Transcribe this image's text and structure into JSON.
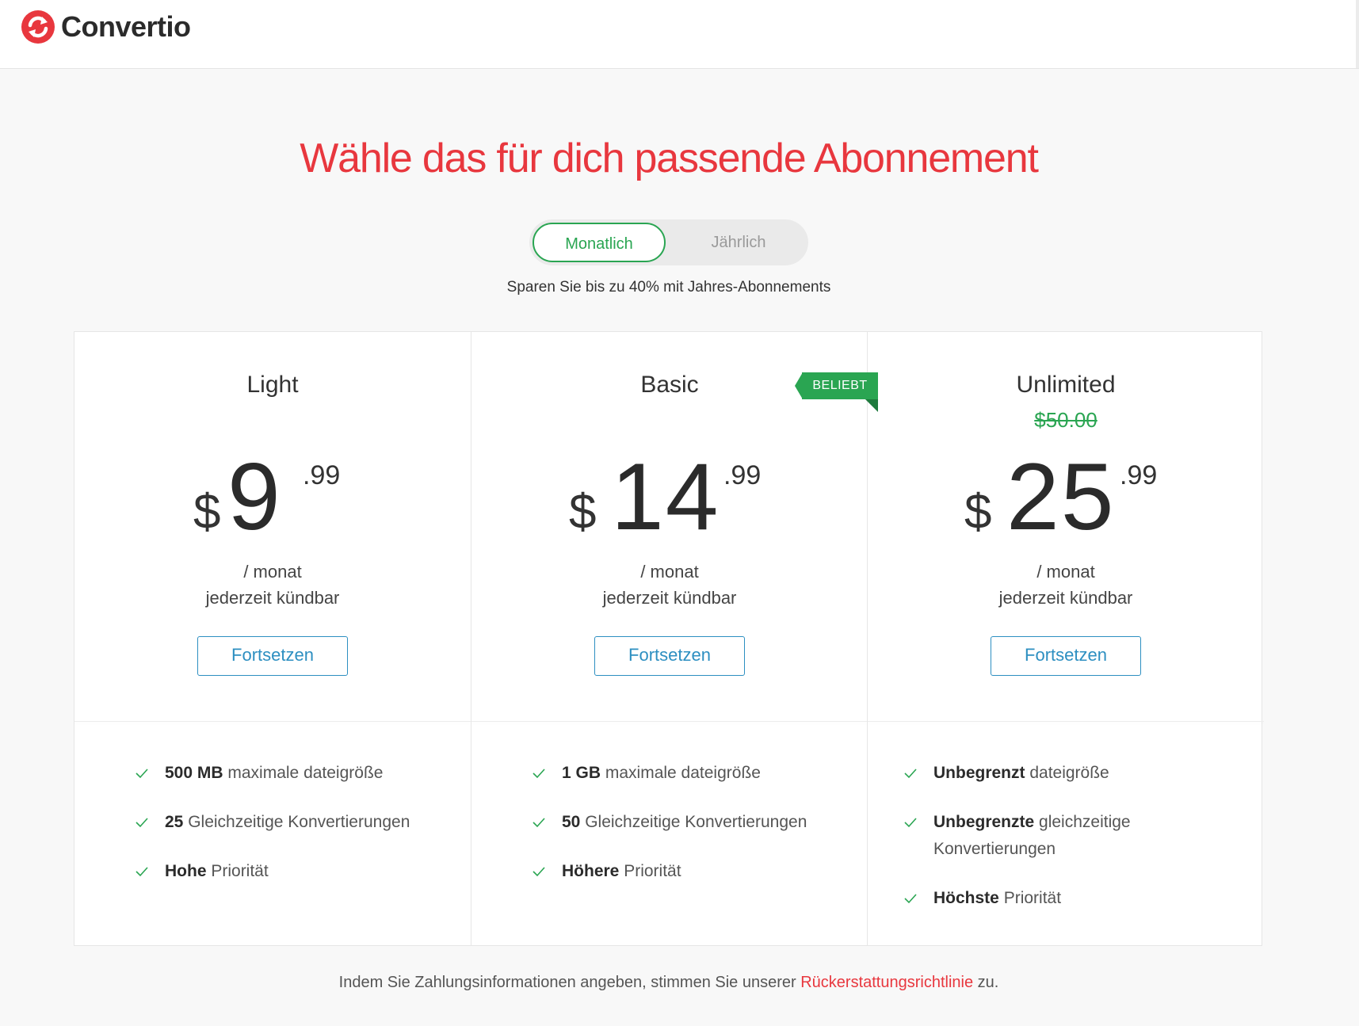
{
  "brand": {
    "name": "Convertio",
    "accent": "#e8373e"
  },
  "headline": "Wähle das für dich passende Abonnement",
  "billing_toggle": {
    "monthly": "Monatlich",
    "yearly": "Jährlich",
    "selected": "Monatlich"
  },
  "save_note": "Sparen Sie bis zu 40% mit Jahres-Abonnements",
  "plans": [
    {
      "name": "Light",
      "old_price": "",
      "currency": "$",
      "price_int": "9",
      "price_dec": ".99",
      "period": "/ monat",
      "cancel": "jederzeit kündbar",
      "button": "Fortsetzen",
      "features": [
        {
          "bold": "500 MB",
          "text": "maximale dateigröße",
          "line2": ""
        },
        {
          "bold": "25",
          "text": "Gleichzeitige Konvertierungen",
          "line2": ""
        },
        {
          "bold": "Hohe",
          "text": "Priorität",
          "line2": ""
        }
      ]
    },
    {
      "name": "Basic",
      "badge": "BELIEBT",
      "old_price": "",
      "currency": "$",
      "price_int": "14",
      "price_dec": ".99",
      "period": "/ monat",
      "cancel": "jederzeit kündbar",
      "button": "Fortsetzen",
      "features": [
        {
          "bold": "1 GB",
          "text": "maximale dateigröße",
          "line2": ""
        },
        {
          "bold": "50",
          "text": "Gleichzeitige Konvertierungen",
          "line2": ""
        },
        {
          "bold": "Höhere",
          "text": "Priorität",
          "line2": ""
        }
      ]
    },
    {
      "name": "Unlimited",
      "old_price": "$50.00",
      "currency": "$",
      "price_int": "25",
      "price_dec": ".99",
      "period": "/ monat",
      "cancel": "jederzeit kündbar",
      "button": "Fortsetzen",
      "features": [
        {
          "bold": "Unbegrenzt",
          "text": "dateigröße",
          "line2": ""
        },
        {
          "bold": "Unbegrenzte",
          "text": "gleichzeitige",
          "line2": "Konvertierungen"
        },
        {
          "bold": "Höchste",
          "text": "Priorität",
          "line2": ""
        }
      ]
    }
  ],
  "footer": {
    "before": "Indem Sie Zahlungsinformationen angeben, stimmen Sie unserer ",
    "link": "Rückerstattungsrichtlinie",
    "after": " zu."
  },
  "colors": {
    "green": "#2aa552",
    "button_blue": "#2d8fc1",
    "headline_red": "#e8373e"
  },
  "icons": [
    "convertio-logo-icon",
    "checkmark-icon"
  ]
}
